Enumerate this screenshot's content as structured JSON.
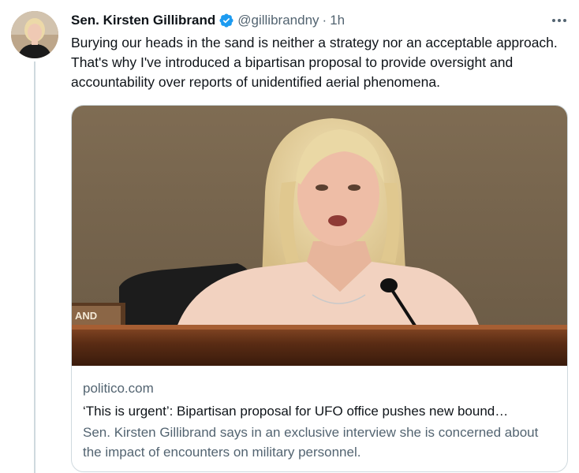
{
  "tweet": {
    "author_name": "Sen. Kirsten Gillibrand",
    "handle": "@gillibrandny",
    "separator": "·",
    "time": "1h",
    "text": "Burying our heads in the sand is neither a strategy nor an acceptable approach. That's why I've introduced a bipartisan proposal to provide oversight and accountability over reports of unidentified aerial phenomena.",
    "verified": true
  },
  "card": {
    "domain": "politico.com",
    "title": "‘This is urgent’: Bipartisan proposal for UFO office pushes new bound…",
    "description": "Sen. Kirsten Gillibrand says in an exclusive interview she is concerned about the impact of encounters on military personnel.",
    "nameplate_text": "AND"
  },
  "icons": {
    "verified": "verified-badge-icon",
    "more": "more-horizontal-icon"
  },
  "colors": {
    "verified_blue": "#1d9bf0",
    "secondary_text": "#536471",
    "border": "#cfd9de"
  }
}
